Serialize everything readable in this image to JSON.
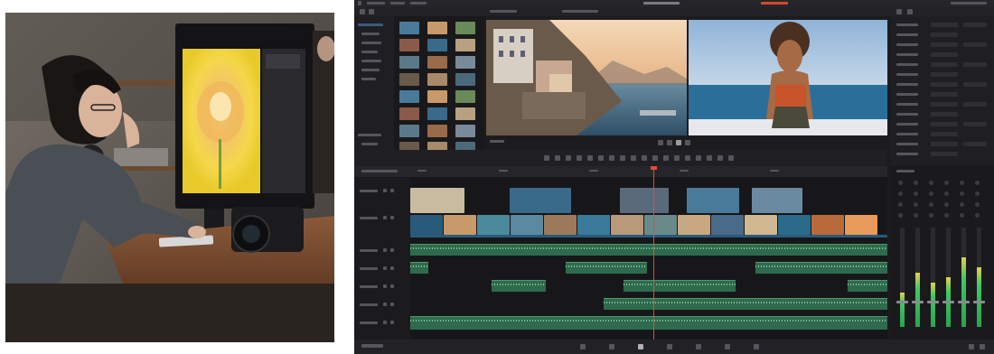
{
  "photo": {
    "subject": "editor-at-workstation-photo"
  },
  "app": {
    "accent": "#d04a2a",
    "playhead_color": "#e64a3a",
    "audio_clip_color": "#2e6b4c",
    "video_clip_color": "#2a5a7a",
    "viewer_left": {
      "scene": "coastal-village-sunset"
    },
    "viewer_right": {
      "scene": "person-on-balcony-ocean"
    }
  }
}
